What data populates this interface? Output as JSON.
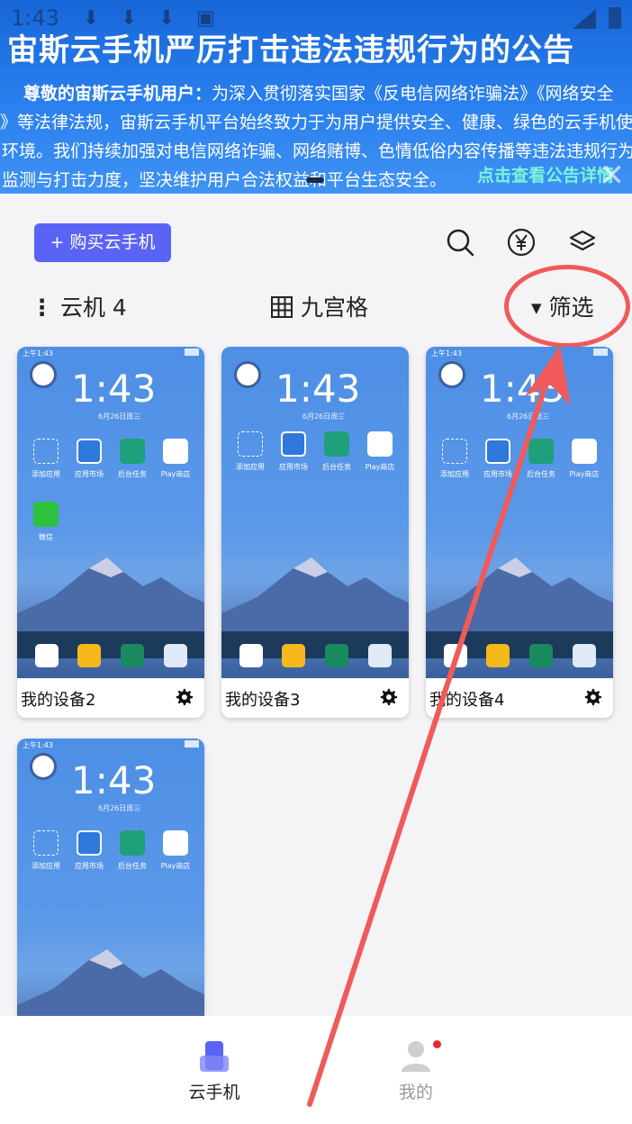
{
  "status_bar": {
    "time": "1:43"
  },
  "banner": {
    "title": "宙斯云手机严厉打击违法违规行为的公告",
    "greeting": "尊敬的宙斯云手机用户：",
    "lines": [
      "为深入贯彻落实国家《反电信网络诈骗法》《网络安全",
      "》等法律法规，宙斯云手机平台始终致力于为用户提供安全、健康、绿色的云手机使",
      "环境。我们持续加强对电信网络诈骗、网络赌博、色情低俗内容传播等违法违规行为",
      "监测与打击力度，坚决维护用户合法权益和平台生态安全。"
    ],
    "link": "点击查看公告详情"
  },
  "toolbar": {
    "buy_label": "+ 购买云手机",
    "icons": [
      "search-icon",
      "yuan-icon",
      "layers-icon"
    ]
  },
  "list_header": {
    "count_label": "云机 4",
    "view_label": "九宫格",
    "filter_label": "筛选"
  },
  "devices": [
    {
      "name": "我的设备2",
      "clock": "1:43",
      "status_time": "上午1:43",
      "date": "6月26日周三",
      "apps": [
        "添加应用",
        "应用市场",
        "后台任务",
        "Play商店",
        "微信"
      ]
    },
    {
      "name": "我的设备3",
      "clock": "1:43",
      "status_time": "",
      "date": "6月26日周三",
      "apps": [
        "添加应用",
        "应用市场",
        "后台任务",
        "Play商店"
      ]
    },
    {
      "name": "我的设备4",
      "clock": "1:43",
      "status_time": "上午1:43",
      "date": "6月26日周三",
      "apps": [
        "添加应用",
        "应用市场",
        "后台任务",
        "Play商店"
      ]
    },
    {
      "name": "",
      "clock": "1:43",
      "status_time": "上午1:43",
      "date": "6月26日周三",
      "apps": [
        "添加应用",
        "应用市场",
        "后台任务",
        "Play商店"
      ]
    }
  ],
  "bottom_nav": {
    "items": [
      {
        "label": "云手机",
        "active": true,
        "color": "#222222"
      },
      {
        "label": "我的",
        "active": false,
        "color": "#9a9a9a"
      }
    ]
  },
  "colors": {
    "accent": "#5b63f5",
    "annotation": "#f05a5a",
    "banner": "#2a80ee"
  }
}
